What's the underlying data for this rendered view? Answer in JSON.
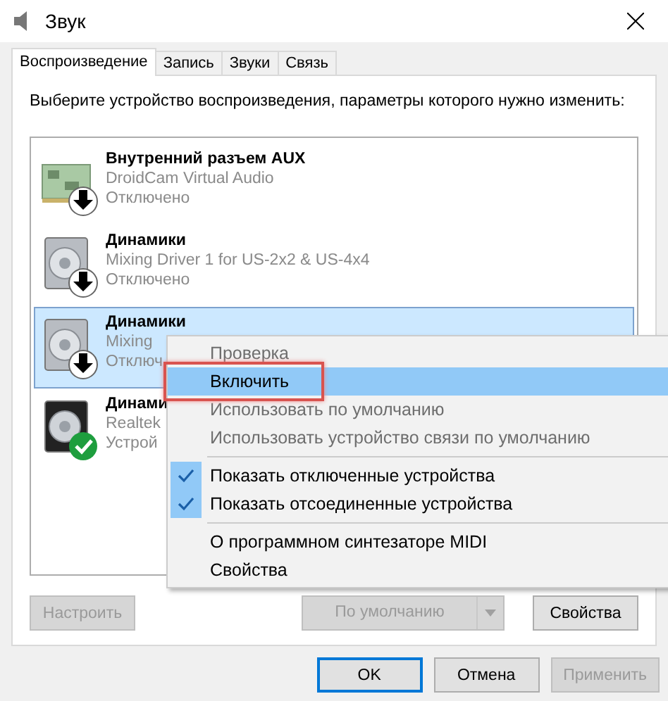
{
  "window": {
    "title": "Звук"
  },
  "tabs": [
    {
      "label": "Воспроизведение",
      "selected": true
    },
    {
      "label": "Запись",
      "selected": false
    },
    {
      "label": "Звуки",
      "selected": false
    },
    {
      "label": "Связь",
      "selected": false
    }
  ],
  "instruction": "Выберите устройство воспроизведения, параметры которого нужно изменить:",
  "devices": [
    {
      "kind": "board",
      "name": "Внутренний разъем  AUX",
      "driver": "DroidCam Virtual Audio",
      "status": "Отключено",
      "default_device": false,
      "selected": false
    },
    {
      "kind": "speaker",
      "name": "Динамики",
      "driver": "Mixing Driver 1 for US-2x2 & US-4x4",
      "status": "Отключено",
      "default_device": false,
      "selected": false
    },
    {
      "kind": "speaker",
      "name": "Динамики",
      "driver": "Mixing",
      "status": "Отключ",
      "default_device": false,
      "selected": true
    },
    {
      "kind": "speaker-dark",
      "name": "Динами",
      "driver": "Realtek",
      "status": "Устрой",
      "default_device": true,
      "selected": false
    }
  ],
  "context_menu": [
    {
      "kind": "item",
      "label": "Проверка",
      "disabled": true,
      "selected": false,
      "checked": false
    },
    {
      "kind": "item",
      "label": "Включить",
      "disabled": false,
      "selected": true,
      "checked": false
    },
    {
      "kind": "item",
      "label": "Использовать по умолчанию",
      "disabled": true,
      "selected": false,
      "checked": false
    },
    {
      "kind": "item",
      "label": "Использовать устройство связи по умолчанию",
      "disabled": true,
      "selected": false,
      "checked": false
    },
    {
      "kind": "separator"
    },
    {
      "kind": "item",
      "label": "Показать отключенные устройства",
      "disabled": false,
      "selected": false,
      "checked": true
    },
    {
      "kind": "item",
      "label": "Показать отсоединенные устройства",
      "disabled": false,
      "selected": false,
      "checked": true
    },
    {
      "kind": "separator"
    },
    {
      "kind": "item",
      "label": "О программном синтезаторе MIDI",
      "disabled": false,
      "selected": false,
      "checked": false
    },
    {
      "kind": "item",
      "label": "Свойства",
      "disabled": false,
      "selected": false,
      "checked": false
    }
  ],
  "panel_buttons": [
    {
      "kind": "button",
      "label": "Настроить",
      "disabled": true
    },
    {
      "kind": "split",
      "label": "По умолчанию",
      "disabled": true
    },
    {
      "kind": "button",
      "label": "Свойства",
      "disabled": false
    }
  ],
  "dialog_buttons": [
    {
      "label": "OK",
      "disabled": false,
      "default": true
    },
    {
      "label": "Отмена",
      "disabled": false,
      "default": false
    },
    {
      "label": "Применить",
      "disabled": true,
      "default": false
    }
  ]
}
